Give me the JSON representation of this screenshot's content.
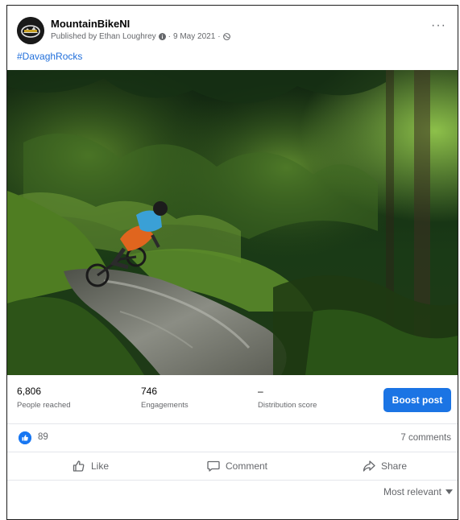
{
  "post": {
    "page_name": "MountainBikeNI",
    "published_by": "Published by Ethan Loughrey",
    "date": "9 May 2021",
    "separator": "·",
    "more_icon": "more-horizontal-icon",
    "hashtag": "#DavaghRocks"
  },
  "photo": {
    "alt": "Mountain biker cornering on a muddy forest trail"
  },
  "insights": {
    "reached_value": "6,806",
    "reached_label": "People reached",
    "engagements_value": "746",
    "engagements_label": "Engagements",
    "distribution_value": "–",
    "distribution_label": "Distribution score",
    "boost_label": "Boost post",
    "boost_color": "#1b74e4"
  },
  "reactions": {
    "like_count": "89",
    "comments": "7 comments"
  },
  "actions": {
    "like": "Like",
    "comment": "Comment",
    "share": "Share"
  },
  "sort": {
    "label": "Most relevant"
  }
}
